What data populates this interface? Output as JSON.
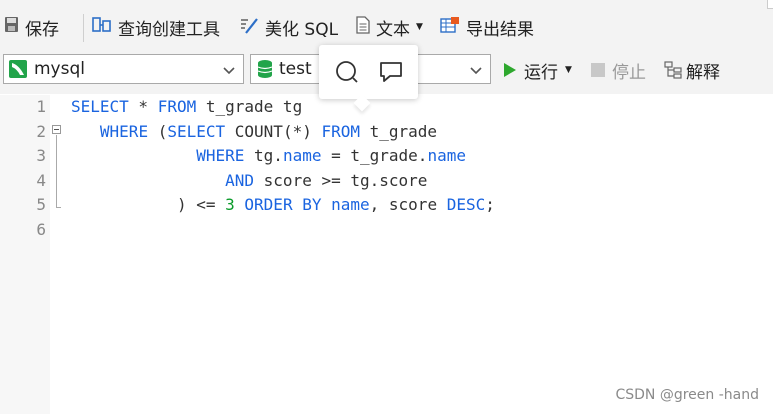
{
  "toolbar": {
    "save_label": "保存",
    "query_builder_label": "查询创建工具",
    "beautify_label": "美化 SQL",
    "text_label": "文本",
    "export_label": "导出结果"
  },
  "connection": {
    "selected": "mysql",
    "database": "test"
  },
  "actions": {
    "run_label": "运行",
    "stop_label": "停止",
    "explain_label": "解释"
  },
  "editor": {
    "line_numbers": [
      "1",
      "2",
      "3",
      "4",
      "5",
      "6"
    ],
    "lines": [
      [
        {
          "t": "SELECT",
          "c": "kw"
        },
        {
          "t": " * ",
          "c": ""
        },
        {
          "t": "FROM",
          "c": "kw"
        },
        {
          "t": " t_grade tg",
          "c": ""
        }
      ],
      [
        {
          "t": "   ",
          "c": ""
        },
        {
          "t": "WHERE",
          "c": "kw"
        },
        {
          "t": " (",
          "c": ""
        },
        {
          "t": "SELECT",
          "c": "kw"
        },
        {
          "t": " COUNT(*) ",
          "c": ""
        },
        {
          "t": "FROM",
          "c": "kw"
        },
        {
          "t": " t_grade",
          "c": ""
        }
      ],
      [
        {
          "t": "             ",
          "c": ""
        },
        {
          "t": "WHERE",
          "c": "kw"
        },
        {
          "t": " tg.",
          "c": ""
        },
        {
          "t": "name",
          "c": "kw"
        },
        {
          "t": " = t_grade.",
          "c": ""
        },
        {
          "t": "name",
          "c": "kw"
        }
      ],
      [
        {
          "t": "                ",
          "c": ""
        },
        {
          "t": "AND",
          "c": "kw"
        },
        {
          "t": " score >= tg.score",
          "c": ""
        }
      ],
      [
        {
          "t": "           ) <= ",
          "c": ""
        },
        {
          "t": "3",
          "c": "num"
        },
        {
          "t": " ",
          "c": ""
        },
        {
          "t": "ORDER BY",
          "c": "kw"
        },
        {
          "t": " ",
          "c": ""
        },
        {
          "t": "name",
          "c": "kw"
        },
        {
          "t": ", score ",
          "c": ""
        },
        {
          "t": "DESC",
          "c": "kw"
        },
        {
          "t": ";",
          "c": ""
        }
      ],
      []
    ]
  },
  "watermark": "CSDN @green -hand",
  "colors": {
    "keyword": "#1a64e0",
    "number": "#0a9b2a",
    "run": "#2ea82e",
    "connection": "#22a44a"
  }
}
